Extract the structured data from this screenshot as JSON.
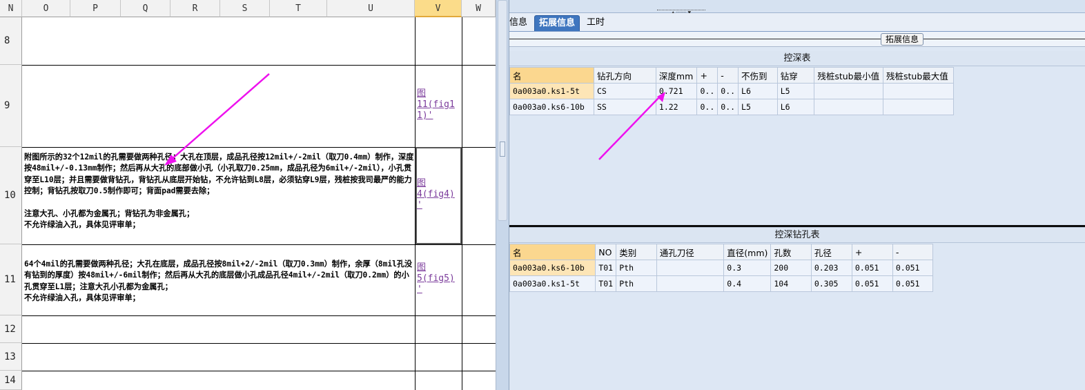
{
  "sheet": {
    "columns": [
      "N",
      "O",
      "P",
      "Q",
      "R",
      "S",
      "T",
      "U",
      "V",
      "W"
    ],
    "rows": [
      "8",
      "9",
      "10",
      "11",
      "12",
      "13",
      "14"
    ],
    "row10_text": "附图所示的32个12mil的孔需要做两种孔径；大孔在顶层，成品孔径按12mil+/-2mil（取刀0.4mm）制作，深度按48mil+/-0.13mm制作；然后再从大孔的底部做小孔（小孔取刀0.25mm，成品孔径为6mil+/-2mil），小孔贯穿至L10层；并且需要做背钻孔，背钻孔从底层开始钻，不允许钻到L8层，必须钻穿L9层，残桩按我司最严的能力控制；背钻孔按取刀0.5制作即可；背面pad需要去除；\n\n注意大孔、小孔都为金属孔；背钻孔为非金属孔；\n不允许绿油入孔，具体见评审单；",
    "row11_text": "64个4mil的孔需要做两种孔径；大孔在底层，成品孔径按8mil+2/-2mil（取刀0.3mm）制作，余厚（8mil孔没有钻到的厚度）按48mil+/-6mil制作；然后再从大孔的底层做小孔成品孔径4mil+/-2mil（取刀0.2mm）的小孔贯穿至L1层；注意大孔小孔都为金属孔；\n不允许绿油入孔，具体见评审单；",
    "link9": "图\n11(fig1\n1)'",
    "link10": "图\n4(fig4)\n'",
    "link11": "图\n5(fig5)\n'"
  },
  "tabs": [
    "信息",
    "拓展信息",
    "工时"
  ],
  "sub_button": "拓展信息",
  "depth_table": {
    "title": "控深表",
    "headers": [
      "名",
      "钻孔方向",
      "深度mm",
      "+",
      "-",
      "不伤到",
      "钻穿",
      "残桩stub最小值",
      "残桩stub最大值"
    ],
    "rows": [
      [
        "0a003a0.ks1-5t",
        "CS",
        "0.721",
        "0..",
        "0..",
        "L6",
        "L5",
        "",
        ""
      ],
      [
        "0a003a0.ks6-10b",
        "SS",
        "1.22",
        "0..",
        "0..",
        "L5",
        "L6",
        "",
        ""
      ]
    ]
  },
  "drill_table": {
    "title": "控深钻孔表",
    "headers": [
      "名",
      "NO",
      "类别",
      "通孔刀径",
      "直径(mm)",
      "孔数",
      "孔径",
      "+",
      "-"
    ],
    "rows": [
      [
        "0a003a0.ks6-10b",
        "T01",
        "Pth",
        "",
        "0.3",
        "200",
        "0.203",
        "0.051",
        "0.051"
      ],
      [
        "0a003a0.ks1-5t",
        "T01",
        "Pth",
        "",
        "0.4",
        "104",
        "0.305",
        "0.051",
        "0.051"
      ]
    ]
  },
  "colors": {
    "arrow": "#ee11ee",
    "tab_active": "#3f76bf",
    "selected_col": "#fbdc8a"
  }
}
